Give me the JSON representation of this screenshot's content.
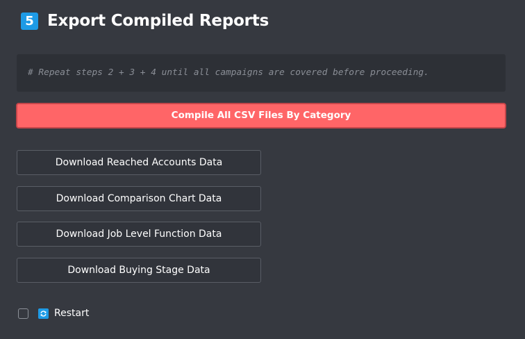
{
  "header": {
    "step_number": "5",
    "title": "Export Compiled Reports"
  },
  "note": {
    "text": "# Repeat steps 2 + 3 + 4 until all campaigns are covered before proceeding."
  },
  "actions": {
    "compile_label": "Compile All CSV Files By Category",
    "downloads": [
      {
        "label": "Download Reached Accounts Data"
      },
      {
        "label": "Download Comparison Chart Data"
      },
      {
        "label": "Download Job Level Function Data"
      },
      {
        "label": "Download Buying Stage Data"
      }
    ]
  },
  "restart": {
    "label": "Restart",
    "checked": false,
    "icon": "refresh-icon"
  },
  "colors": {
    "background": "#363940",
    "accent_blue": "#1e9be6",
    "primary_button": "#ff6567"
  }
}
